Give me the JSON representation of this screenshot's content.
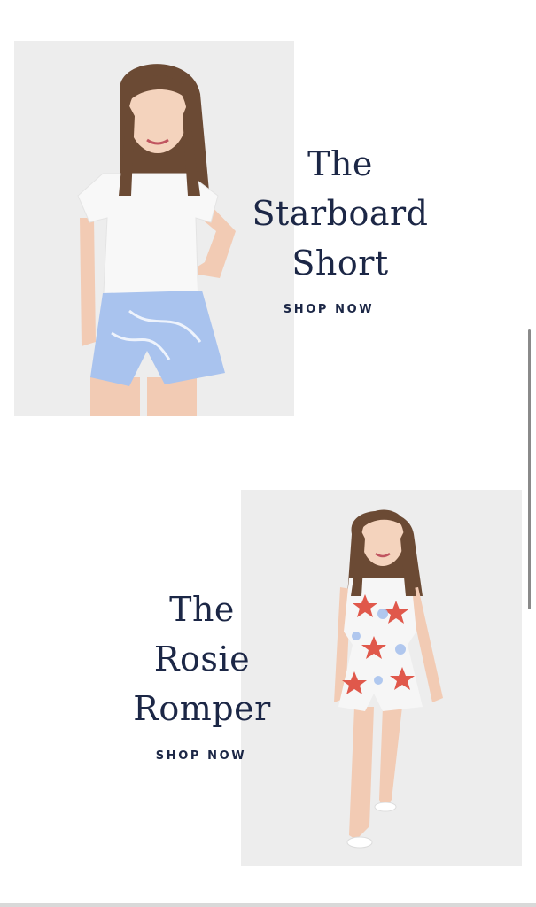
{
  "products": [
    {
      "title_lines": [
        "The",
        "Starboard",
        "Short"
      ],
      "cta": "SHOP NOW"
    },
    {
      "title_lines": [
        "The",
        "Rosie",
        "Romper"
      ],
      "cta": "SHOP NOW"
    }
  ],
  "colors": {
    "text": "#1c2746",
    "photo_background": "#eeeeee",
    "shorts": "#a9c3ee",
    "romper_print": "#e0584b"
  }
}
